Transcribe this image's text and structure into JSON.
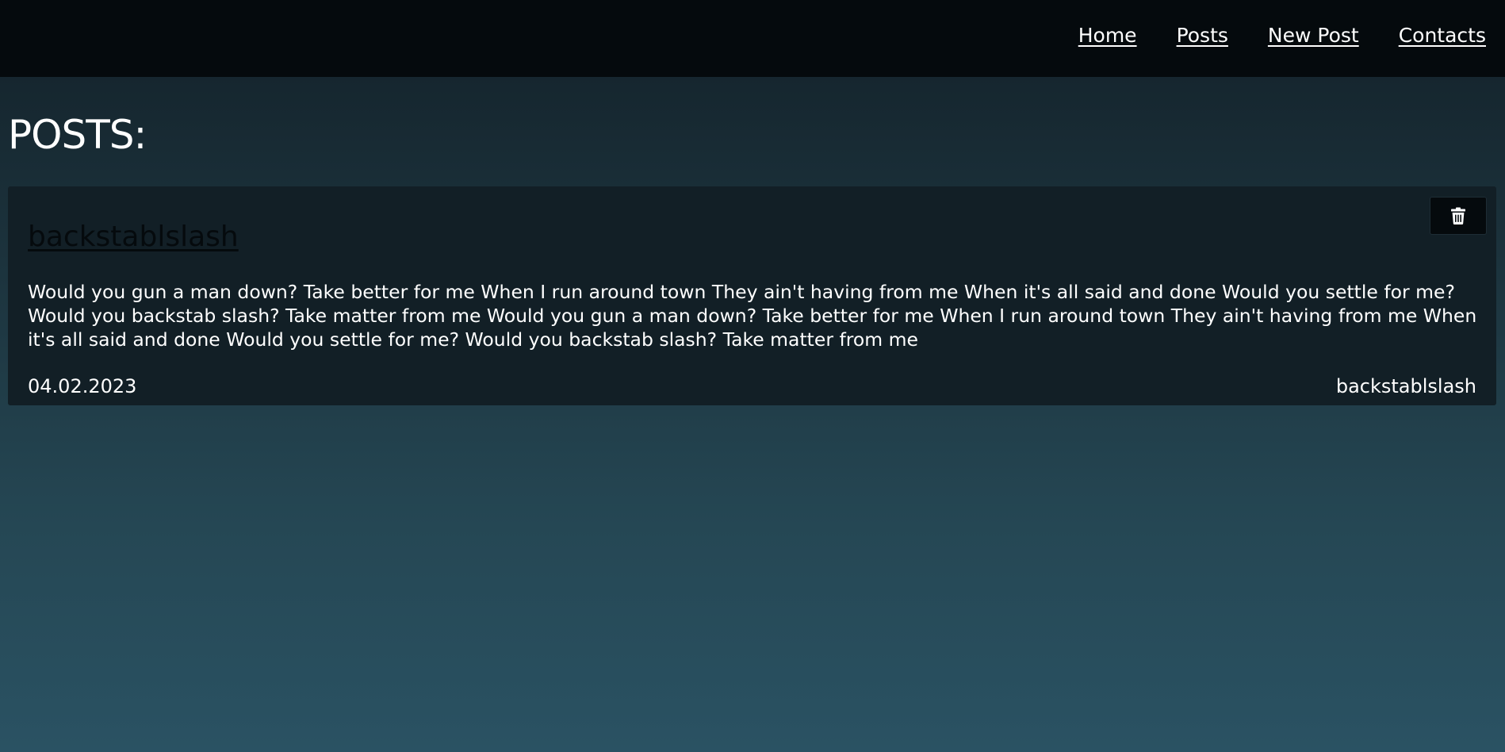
{
  "nav": {
    "items": [
      {
        "label": "Home"
      },
      {
        "label": "Posts"
      },
      {
        "label": "New Post"
      },
      {
        "label": "Contacts"
      }
    ]
  },
  "page": {
    "title": "POSTS:"
  },
  "posts": [
    {
      "title": "backstablslash",
      "body": "Would you gun a man down? Take better for me When I run around town They ain't having from me When it's all said and done Would you settle for me? Would you backstab slash? Take matter from me Would you gun a man down? Take better for me When I run around town They ain't having from me When it's all said and done Would you settle for me? Would you backstab slash? Take matter from me",
      "date": "04.02.2023",
      "author": "backstablslash",
      "delete_icon": "trash-icon"
    }
  ],
  "colors": {
    "navbar_bg": "#050a0d",
    "card_bg": "#121f26",
    "text": "#ffffff",
    "post_title": "#050a0d"
  }
}
